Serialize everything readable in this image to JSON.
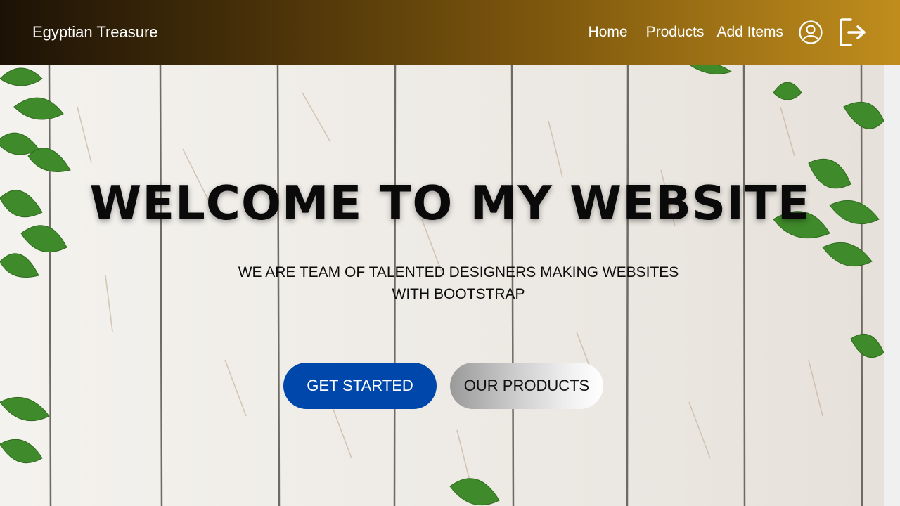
{
  "navbar": {
    "brand": "Egyptian Treasure",
    "links": [
      "Home",
      "Products",
      "Add Items"
    ],
    "icons": [
      "user-circle-icon",
      "logout-icon"
    ],
    "gradient": [
      "#1c1206",
      "#c08d1d"
    ]
  },
  "hero": {
    "title": "WELCOME TO MY WEBSITE",
    "subtitle_line1": "WE ARE TEAM OF TALENTED DESIGNERS MAKING WEBSITES",
    "subtitle_line2": "WITH BOOTSTRAP",
    "primary_button": "GET STARTED",
    "secondary_button": "OUR PRODUCTS",
    "primary_color": "#0047ab"
  }
}
